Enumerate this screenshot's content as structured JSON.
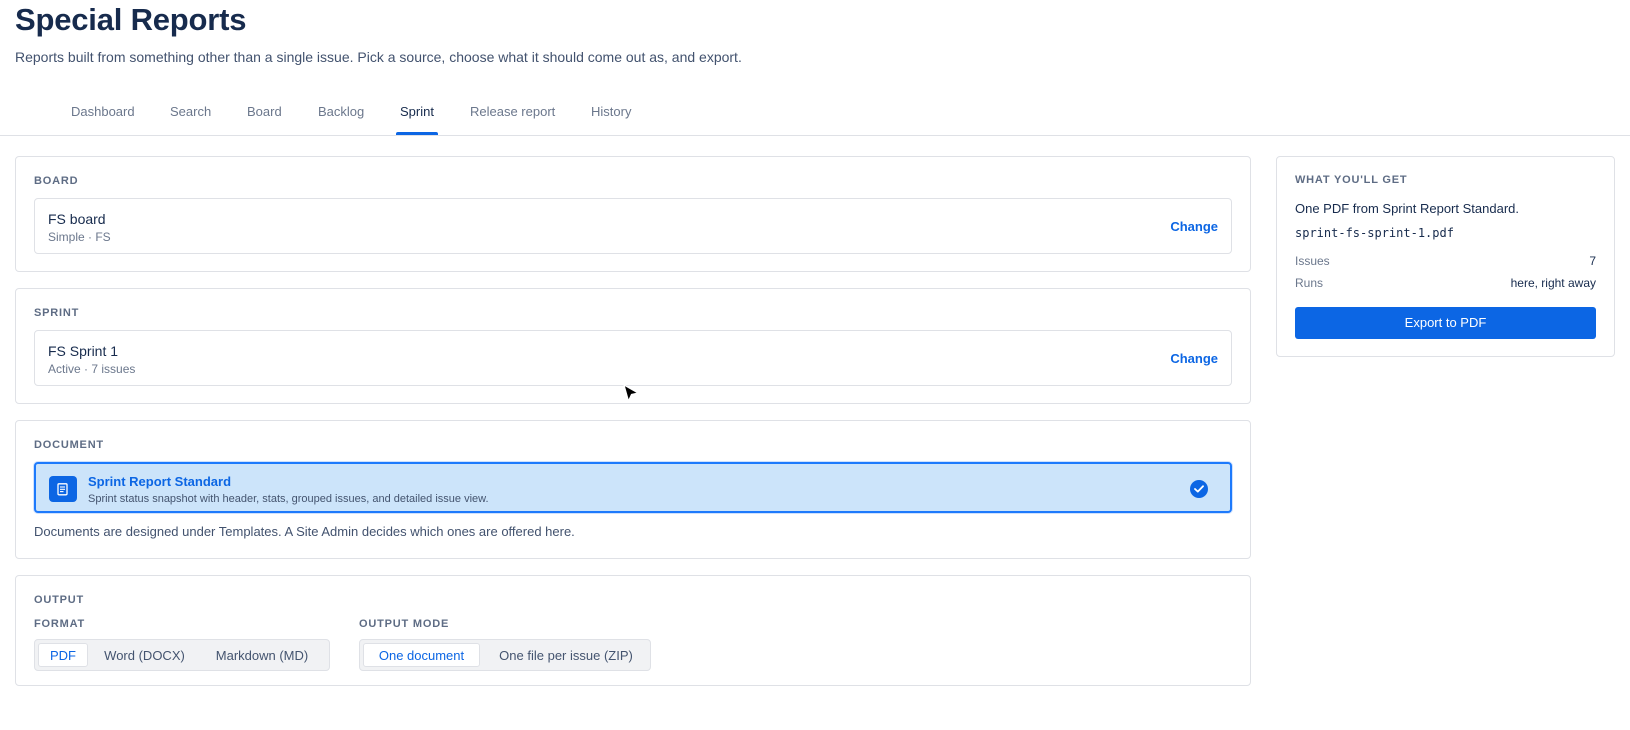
{
  "header": {
    "title": "Special Reports",
    "subtitle": "Reports built from something other than a single issue. Pick a source, choose what it should come out as, and export."
  },
  "tabs": [
    {
      "label": "Dashboard"
    },
    {
      "label": "Search"
    },
    {
      "label": "Board"
    },
    {
      "label": "Backlog"
    },
    {
      "label": "Sprint",
      "active": true
    },
    {
      "label": "Release report"
    },
    {
      "label": "History"
    }
  ],
  "board": {
    "section_label": "BOARD",
    "name": "FS board",
    "meta": "Simple · FS",
    "change_label": "Change"
  },
  "sprint": {
    "section_label": "SPRINT",
    "name": "FS Sprint 1",
    "meta": "Active · 7 issues",
    "change_label": "Change"
  },
  "document": {
    "section_label": "DOCUMENT",
    "selected_title": "Sprint Report Standard",
    "selected_desc": "Sprint status snapshot with header, stats, grouped issues, and detailed issue view.",
    "note": "Documents are designed under Templates. A Site Admin decides which ones are offered here.",
    "icon": "document-icon"
  },
  "output": {
    "section_label": "OUTPUT",
    "format_label": "FORMAT",
    "formats": [
      "PDF",
      "Word (DOCX)",
      "Markdown (MD)"
    ],
    "selected_format": "PDF",
    "mode_label": "OUTPUT MODE",
    "modes": [
      "One document",
      "One file per issue (ZIP)"
    ],
    "selected_mode": "One document"
  },
  "summary": {
    "label": "WHAT YOU'LL GET",
    "description": "One PDF from Sprint Report Standard.",
    "filename": "sprint-fs-sprint-1.pdf",
    "issues_key": "Issues",
    "issues_value": "7",
    "runs_key": "Runs",
    "runs_value": "here, right away",
    "export_label": "Export to PDF"
  },
  "colors": {
    "accent": "#0c66e4",
    "selected_bg": "#cce4fa",
    "border": "#dfe1e6"
  }
}
